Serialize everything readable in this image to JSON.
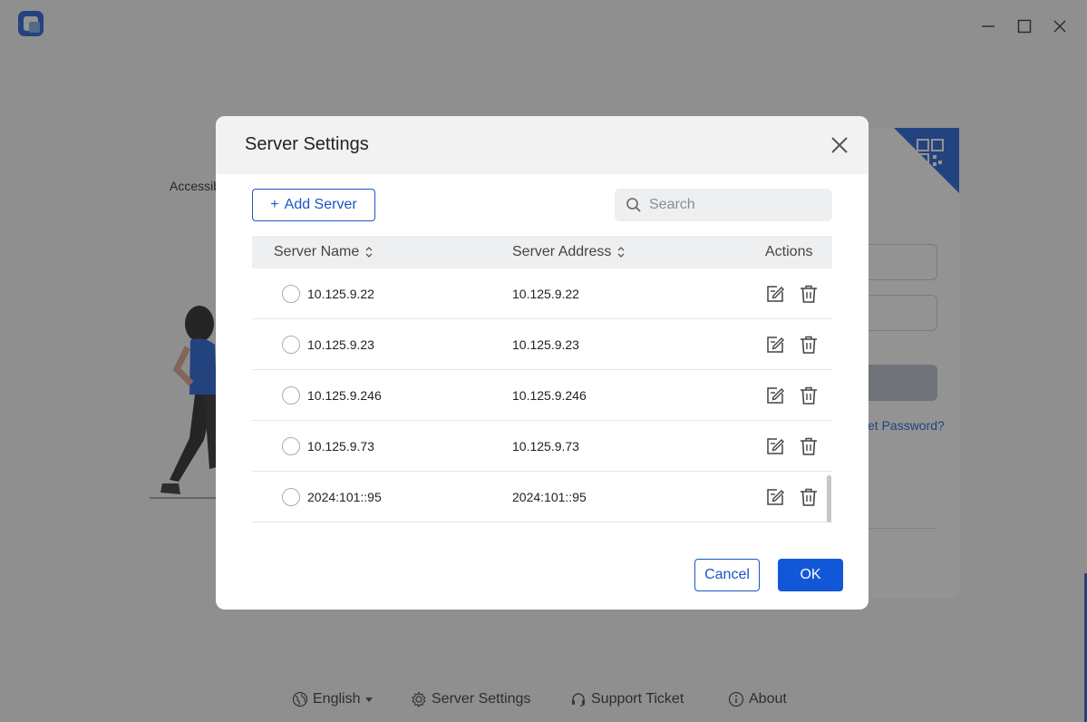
{
  "background": {
    "left_label": "Accessib",
    "forgot_password": "et Password?",
    "footer": {
      "language": "English",
      "server_settings": "Server Settings",
      "support_ticket": "Support Ticket",
      "about": "About"
    }
  },
  "dialog": {
    "title": "Server Settings",
    "add_server_label": "Add Server",
    "search_placeholder": "Search",
    "columns": {
      "name": "Server Name",
      "address": "Server Address",
      "actions": "Actions"
    },
    "rows": [
      {
        "name": "10.125.9.22",
        "address": "10.125.9.22"
      },
      {
        "name": "10.125.9.23",
        "address": "10.125.9.23"
      },
      {
        "name": "10.125.9.246",
        "address": "10.125.9.246"
      },
      {
        "name": "10.125.9.73",
        "address": "10.125.9.73"
      },
      {
        "name": "2024:101::95",
        "address": "2024:101::95"
      }
    ],
    "cancel_label": "Cancel",
    "ok_label": "OK"
  },
  "colors": {
    "primary": "#1257d8",
    "outline": "#1a55c4",
    "header_bg": "#f2f2f2",
    "table_head_bg": "#eeeff1"
  }
}
